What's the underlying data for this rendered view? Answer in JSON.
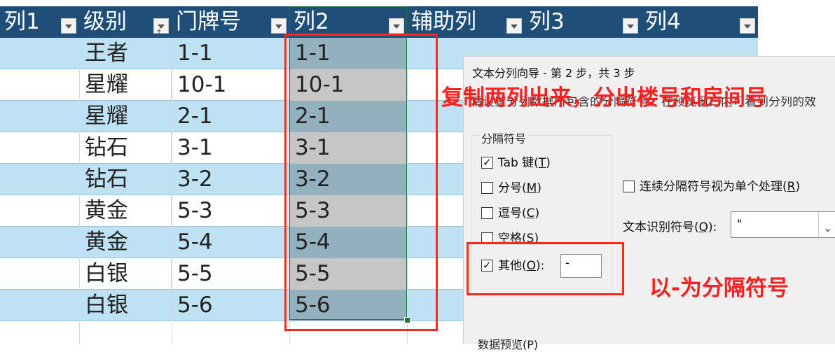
{
  "headers": [
    {
      "label": "列1",
      "sorted": false
    },
    {
      "label": "级别",
      "sorted": true
    },
    {
      "label": "门牌号",
      "sorted": false
    },
    {
      "label": "列2",
      "sorted": false
    },
    {
      "label": "辅助列",
      "sorted": false
    },
    {
      "label": "列3",
      "sorted": false
    },
    {
      "label": "列4",
      "sorted": false
    }
  ],
  "rows": [
    {
      "level": "王者",
      "room": "1-1",
      "col2": "1-1"
    },
    {
      "level": "星耀",
      "room": "10-1",
      "col2": "10-1"
    },
    {
      "level": "星耀",
      "room": "2-1",
      "col2": "2-1"
    },
    {
      "level": "钻石",
      "room": "3-1",
      "col2": "3-1"
    },
    {
      "level": "钻石",
      "room": "3-2",
      "col2": "3-2"
    },
    {
      "level": "黄金",
      "room": "5-3",
      "col2": "5-3"
    },
    {
      "level": "黄金",
      "room": "5-4",
      "col2": "5-4"
    },
    {
      "level": "白银",
      "room": "5-5",
      "col2": "5-5"
    },
    {
      "level": "白银",
      "room": "5-6",
      "col2": "5-6"
    }
  ],
  "dialog": {
    "title": "文本分列向导 - 第 2 步，共 3 步",
    "description": "请设置分列数据所包含的分隔符号。在预览窗口内可看到分列的效",
    "delimiters_group": "分隔符号",
    "options": {
      "tab": {
        "label": "Tab 键(",
        "key": "T",
        "end": ")",
        "checked": true
      },
      "semicolon": {
        "label": "分号(",
        "key": "M",
        "end": ")",
        "checked": false
      },
      "comma": {
        "label": "逗号(",
        "key": "C",
        "end": ")",
        "checked": false
      },
      "space": {
        "label": "空格(",
        "key": "S",
        "end": ")",
        "checked": false
      },
      "other": {
        "label": "其他(",
        "key": "O",
        "end": "):",
        "checked": true,
        "value": "-"
      }
    },
    "consecutive": {
      "label": "连续分隔符号视为单个处理(",
      "key": "R",
      "end": ")",
      "checked": false
    },
    "qualifier_label": "文本识别符号(",
    "qualifier_key": "Q",
    "qualifier_end": "):",
    "qualifier_value": "\"",
    "preview_label": "数据预览(P)"
  },
  "annotations": {
    "copy_note": "复制两列出来，分出楼号和房间号",
    "delimiter_note": "以-为分隔符号"
  },
  "colors": {
    "header": "#1f4e79",
    "band": "#bee2f3",
    "selection_fill": "#93b0bf",
    "annotation": "#ff1f1f"
  }
}
